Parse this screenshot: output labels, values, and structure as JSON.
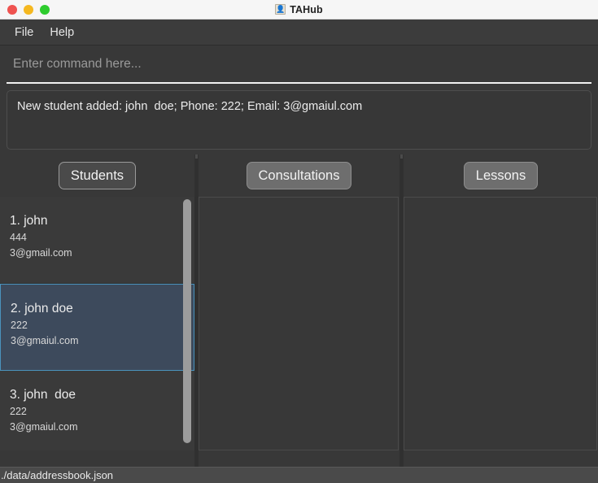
{
  "window": {
    "title": "TAHub",
    "icon": "person-icon",
    "controls": [
      {
        "name": "close",
        "color": "#ef5350"
      },
      {
        "name": "minimize",
        "color": "#f5b820"
      },
      {
        "name": "maximize",
        "color": "#2ecc2e"
      }
    ]
  },
  "menubar": {
    "items": [
      {
        "label": "File"
      },
      {
        "label": "Help"
      }
    ]
  },
  "command": {
    "value": "",
    "placeholder": "Enter command here..."
  },
  "result": {
    "text": "New student added: john  doe; Phone: 222; Email: 3@gmaiul.com"
  },
  "panels": [
    {
      "key": "students",
      "tab_label": "Students",
      "active": true,
      "items": [
        {
          "name": "1. john",
          "phone": "444",
          "email": "3@gmail.com",
          "selected": false
        },
        {
          "name": "2. john doe",
          "phone": "222",
          "email": "3@gmaiul.com",
          "selected": true
        },
        {
          "name": "3. john  doe",
          "phone": "222",
          "email": "3@gmaiul.com",
          "selected": false
        }
      ]
    },
    {
      "key": "consultations",
      "tab_label": "Consultations",
      "active": false,
      "items": []
    },
    {
      "key": "lessons",
      "tab_label": "Lessons",
      "active": false,
      "items": []
    }
  ],
  "statusbar": {
    "file_path": "./data/addressbook.json"
  },
  "colors": {
    "window_bg": "#383838",
    "titlebar_bg": "#f6f6f6",
    "menubar_bg": "#3c3c3c",
    "selection_bg": "#3d4a5c",
    "selection_border": "#4a93bd",
    "statusbar_bg": "#4a4a4a",
    "accent_text": "#ececec"
  }
}
